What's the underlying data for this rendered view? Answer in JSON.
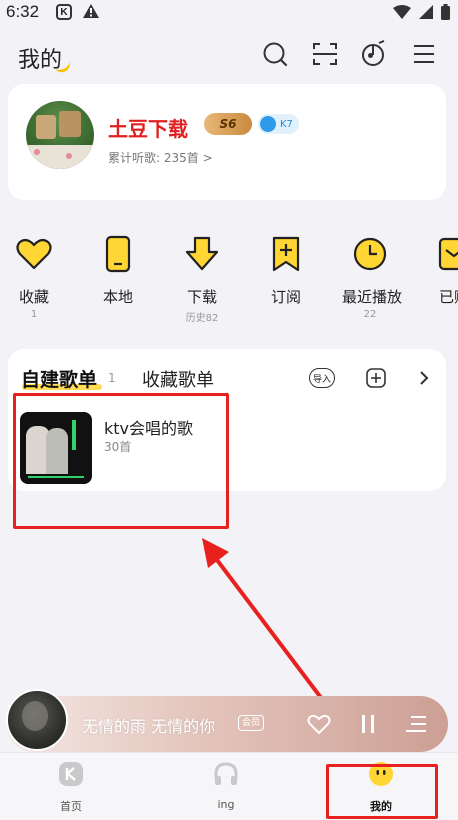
{
  "status_bar": {
    "time": "6:32",
    "app_icon_letter": "K"
  },
  "header": {
    "title": "我的",
    "icons": [
      "search-icon",
      "scan-icon",
      "music-radar-icon",
      "menu-icon"
    ]
  },
  "profile": {
    "username": "土豆下载",
    "vip_badge": "S6",
    "level_badge": "K7",
    "listen_count": "累计听歌: 235首 >"
  },
  "quick_actions": [
    {
      "label": "收藏",
      "sub": "1",
      "icon": "heart-icon"
    },
    {
      "label": "本地",
      "sub": "",
      "icon": "phone-icon"
    },
    {
      "label": "下载",
      "sub": "历史82",
      "icon": "download-icon"
    },
    {
      "label": "订阅",
      "sub": "",
      "icon": "subscribe-icon"
    },
    {
      "label": "最近播放",
      "sub": "22",
      "icon": "clock-icon"
    },
    {
      "label": "已购",
      "sub": "",
      "icon": "purchased-icon"
    }
  ],
  "playlists": {
    "tab_created": "自建歌单",
    "tab_created_count": "1",
    "tab_favorite": "收藏歌单",
    "import_label": "导入",
    "items": [
      {
        "name": "ktv会唱的歌",
        "count": "30首"
      }
    ]
  },
  "player": {
    "title": "无情的雨 无情的你",
    "tag": "会员"
  },
  "bottom_nav": [
    {
      "label": "首页",
      "icon": "home-k-icon"
    },
    {
      "label": "ing",
      "icon": "headphones-icon"
    },
    {
      "label": "我的",
      "icon": "mine-face-icon",
      "active": true
    }
  ],
  "colors": {
    "accent": "#ffd633",
    "username": "#e02020",
    "annotation": "#e8211f"
  }
}
